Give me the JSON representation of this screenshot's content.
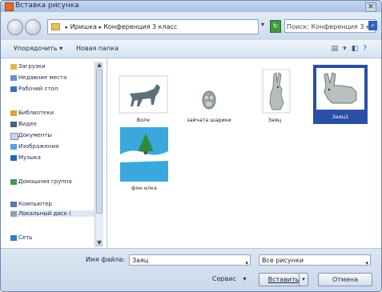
{
  "window": {
    "title": "Вставка рисунка",
    "close_glyph": "✕"
  },
  "address": {
    "path": [
      "Иришка",
      "Конференция 3 класс"
    ],
    "search_placeholder": "Поиск: Конференция 3 класс"
  },
  "toolbar": {
    "organize": "Упорядочить ▾",
    "new_folder": "Новая папка"
  },
  "sidebar": {
    "items": [
      {
        "label": "Загрузки",
        "icon": "downloads-icon"
      },
      {
        "label": "Недавние места",
        "icon": "recent-places-icon"
      },
      {
        "label": "Рабочий стол",
        "icon": "desktop-icon"
      },
      {
        "label": "Библиотеки",
        "icon": "libraries-icon"
      },
      {
        "label": "Видео",
        "icon": "video-icon"
      },
      {
        "label": "Документы",
        "icon": "documents-icon"
      },
      {
        "label": "Изображения",
        "icon": "pictures-icon"
      },
      {
        "label": "Музыка",
        "icon": "music-icon"
      },
      {
        "label": "Домашняя группа",
        "icon": "homegroup-icon"
      },
      {
        "label": "Компьютер",
        "icon": "computer-icon"
      },
      {
        "label": "Локальный диск (",
        "icon": "local-disk-icon"
      },
      {
        "label": "Сеть",
        "icon": "network-icon"
      }
    ]
  },
  "files": [
    {
      "name": "Волк",
      "selected": false
    },
    {
      "name": "зайчата шарики",
      "selected": false
    },
    {
      "name": "Заяц",
      "selected": false
    },
    {
      "name": "Заяц1",
      "selected": true
    },
    {
      "name": "фон елка",
      "selected": false
    }
  ],
  "footer": {
    "filename_label": "Имя файла:",
    "filename_value": "Заяц",
    "filetype_value": "Все рисунки",
    "service_label": "Сервис",
    "insert_label": "Вставить",
    "cancel_label": "Отмена"
  }
}
